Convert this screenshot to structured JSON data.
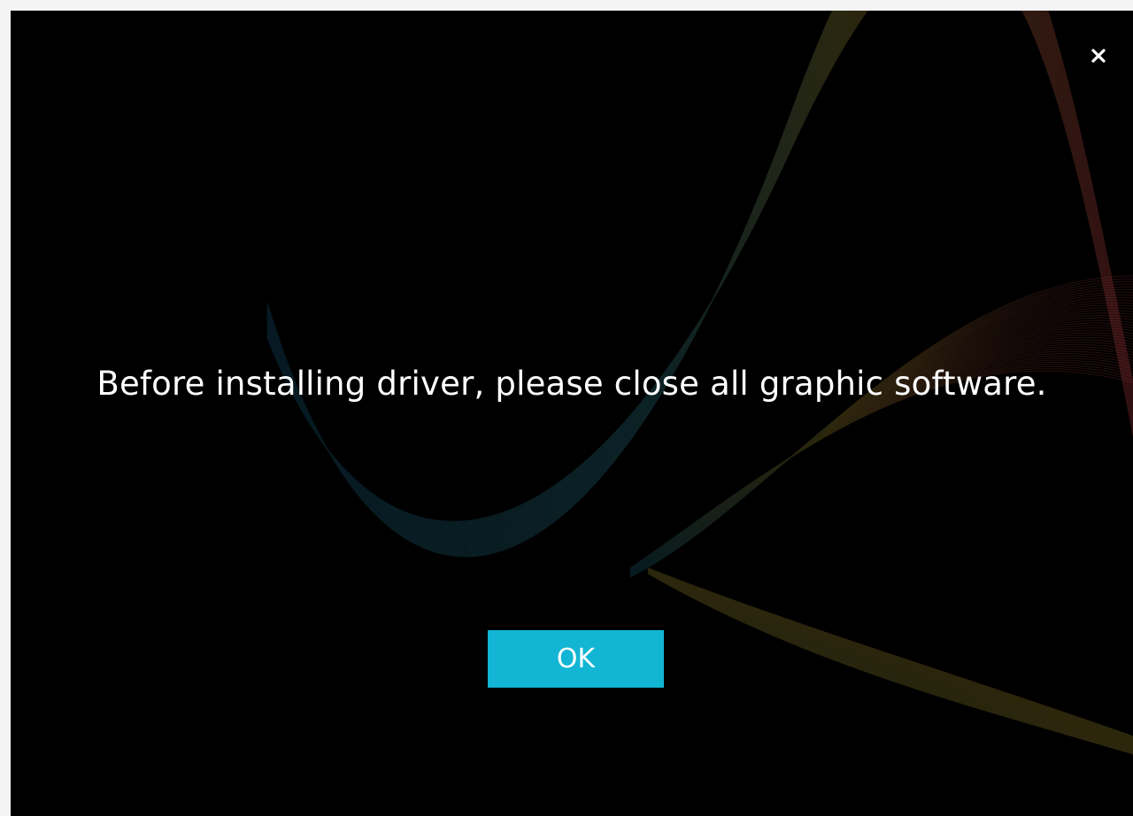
{
  "dialog": {
    "message": "Before installing driver, please close all graphic software.",
    "ok_label": "OK",
    "close_icon": "close-icon"
  },
  "colors": {
    "background": "#000000",
    "accent": "#12b6d4",
    "text": "#ffffff"
  }
}
